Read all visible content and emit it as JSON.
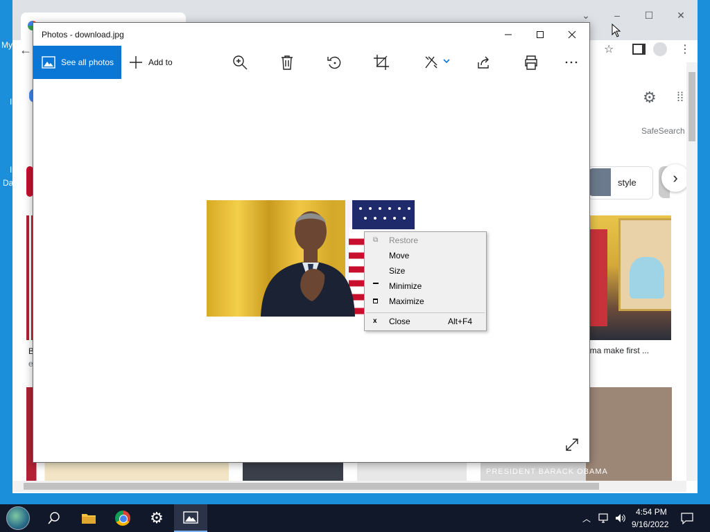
{
  "desktop": {
    "icon_labels": [
      "My",
      "I",
      "I",
      "Da"
    ]
  },
  "chrome": {
    "results": {
      "chip_style": "style",
      "safesearch": "SafeSearch",
      "caption_left_a": "B",
      "caption_left_b": "e",
      "caption_right": "ama make first ...",
      "photo_caption_bottom": "PRESIDENT BARACK OBAMA"
    }
  },
  "photos": {
    "window_title": "Photos - download.jpg",
    "toolbar": {
      "see_all": "See all photos",
      "add_to": "Add to"
    },
    "icons": [
      "zoom-in-icon",
      "delete-icon",
      "rotate-icon",
      "crop-icon",
      "edit-icon",
      "share-icon",
      "print-icon",
      "more-icon",
      "expand-icon"
    ]
  },
  "context_menu": {
    "items": [
      {
        "label": "Restore",
        "shortcut": "",
        "enabled": false
      },
      {
        "label": "Move",
        "shortcut": "",
        "enabled": true
      },
      {
        "label": "Size",
        "shortcut": "",
        "enabled": true
      },
      {
        "label": "Minimize",
        "shortcut": "",
        "enabled": true
      },
      {
        "label": "Maximize",
        "shortcut": "",
        "enabled": true
      },
      {
        "label": "Close",
        "shortcut": "Alt+F4",
        "enabled": true
      }
    ]
  },
  "taskbar": {
    "time": "4:54 PM",
    "date": "9/16/2022"
  },
  "colors": {
    "accent": "#0a77d6",
    "taskbar": "#10182a",
    "desktop": "#1b8fd9"
  }
}
